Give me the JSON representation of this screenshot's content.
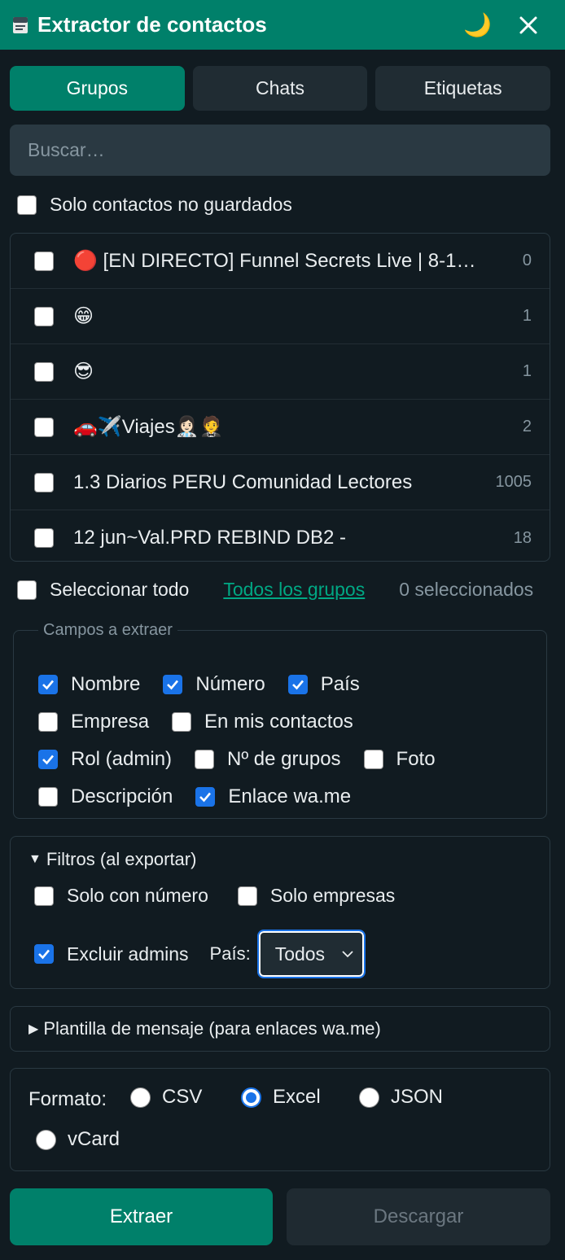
{
  "header": {
    "title": "Extractor de contactos",
    "moon_glyph": "🌙",
    "brand_color": "#00806a"
  },
  "tabs": [
    {
      "label": "Grupos",
      "active": true
    },
    {
      "label": "Chats",
      "active": false
    },
    {
      "label": "Etiquetas",
      "active": false
    }
  ],
  "search": {
    "placeholder": "Buscar…",
    "value": ""
  },
  "unsaved_only": {
    "label": "Solo contactos no guardados",
    "checked": false
  },
  "groups": [
    {
      "name": "🔴 [EN DIRECTO] Funnel Secrets Live | 8-1…",
      "count": "0",
      "checked": false
    },
    {
      "name": "😁",
      "count": "1",
      "checked": false
    },
    {
      "name": "😎",
      "count": "1",
      "checked": false
    },
    {
      "name": "🚗✈️Viajes👩🏻‍⚕️🤵",
      "count": "2",
      "checked": false
    },
    {
      "name": "1.3 Diarios PERU Comunidad Lectores",
      "count": "1005",
      "checked": false
    },
    {
      "name": "12 jun~Val.PRD REBIND DB2 -",
      "count": "18",
      "checked": false
    }
  ],
  "selection": {
    "select_all_label": "Seleccionar todo",
    "all_groups_link": "Todos los grupos",
    "selected_count": "0 seleccionados"
  },
  "fields": {
    "legend": "Campos a extraer",
    "rows": [
      [
        {
          "label": "Nombre",
          "checked": true
        },
        {
          "label": "Número",
          "checked": true
        },
        {
          "label": "País",
          "checked": true
        }
      ],
      [
        {
          "label": "Empresa",
          "checked": false
        },
        {
          "label": "En mis contactos",
          "checked": false
        }
      ],
      [
        {
          "label": "Rol (admin)",
          "checked": true
        },
        {
          "label": "Nº de grupos",
          "checked": false
        },
        {
          "label": "Foto",
          "checked": false
        }
      ],
      [
        {
          "label": "Descripción",
          "checked": false
        },
        {
          "label": "Enlace wa.me",
          "checked": true
        }
      ]
    ]
  },
  "filters": {
    "summary": "Filtros (al exportar)",
    "only_with_number": {
      "label": "Solo con número",
      "checked": false
    },
    "only_business": {
      "label": "Solo empresas",
      "checked": false
    },
    "exclude_admins": {
      "label": "Excluir admins",
      "checked": true
    },
    "country_label": "País:",
    "country_value": "Todos"
  },
  "template": {
    "summary": "Plantilla de mensaje (para enlaces wa.me)"
  },
  "format": {
    "label": "Formato:",
    "options": [
      {
        "label": "CSV",
        "selected": false
      },
      {
        "label": "Excel",
        "selected": true
      },
      {
        "label": "JSON",
        "selected": false
      },
      {
        "label": "vCard",
        "selected": false
      }
    ]
  },
  "actions": {
    "extract": "Extraer",
    "download": "Descargar"
  }
}
